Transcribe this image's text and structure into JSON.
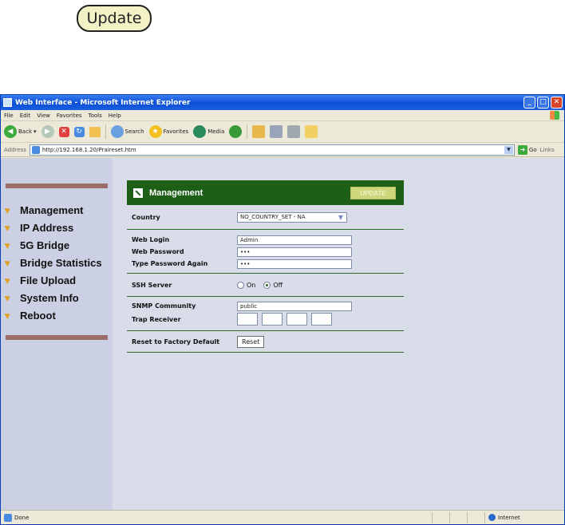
{
  "callout": {
    "label": "Update"
  },
  "window": {
    "title": "Web Interface - Microsoft Internet Explorer",
    "controls": {
      "minimize": "_",
      "maximize": "□",
      "close": "✕"
    }
  },
  "menu": [
    "File",
    "Edit",
    "View",
    "Favorites",
    "Tools",
    "Help"
  ],
  "toolbar": {
    "back": "Back",
    "search": "Search",
    "favorites": "Favorites",
    "media": "Media"
  },
  "address": {
    "label": "Address",
    "url": "http://192.168.1.20/Praireset.htm",
    "go": "Go",
    "links": "Links"
  },
  "sidebar": {
    "items": [
      {
        "label": "Management"
      },
      {
        "label": "IP Address"
      },
      {
        "label": "5G Bridge"
      },
      {
        "label": "Bridge Statistics"
      },
      {
        "label": "File Upload"
      },
      {
        "label": "System Info"
      },
      {
        "label": "Reboot"
      }
    ]
  },
  "panel": {
    "title": "Management",
    "update_label": "UPDATE",
    "country_label": "Country",
    "country_value": "NO_COUNTRY_SET - NA",
    "web_login_label": "Web Login",
    "web_login_value": "Admin",
    "web_password_label": "Web Password",
    "web_password_value": "•••",
    "type_password_label": "Type Password Again",
    "type_password_value": "•••",
    "ssh_label": "SSH Server",
    "ssh_on": "On",
    "ssh_off": "Off",
    "ssh_selected": "Off",
    "snmp_label": "SNMP Community",
    "snmp_value": "public",
    "trap_label": "Trap Receiver",
    "reset_label": "Reset to Factory Default",
    "reset_button": "Reset"
  },
  "status": {
    "text": "Done",
    "zone": "Internet"
  }
}
